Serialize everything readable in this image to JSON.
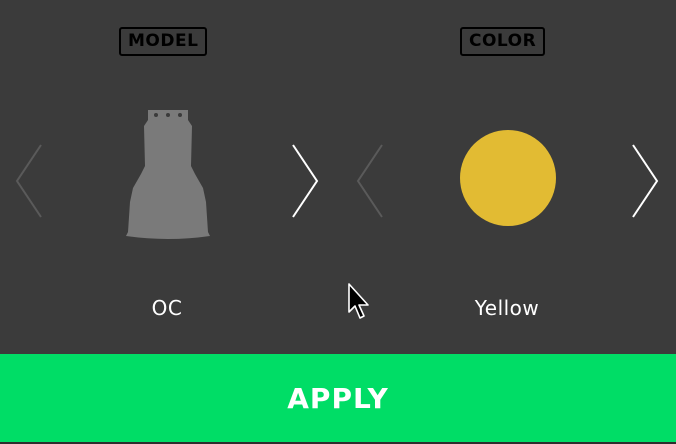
{
  "model": {
    "section_label": "MODEL",
    "value": "OC",
    "preview_icon": "lamp-shade-icon",
    "preview_color": "#7a7a7a",
    "prev_icon": "chevron-left-icon",
    "next_icon": "chevron-right-icon"
  },
  "color": {
    "section_label": "COLOR",
    "value": "Yellow",
    "swatch_color": "#e2bb33",
    "prev_icon": "chevron-left-icon",
    "next_icon": "chevron-right-icon"
  },
  "apply_button": {
    "label": "APPLY",
    "color": "#00dd66"
  },
  "theme": {
    "background": "#3b3b3b",
    "arrow_enabled": "#ffffff",
    "arrow_disabled": "#5a5a5a"
  }
}
